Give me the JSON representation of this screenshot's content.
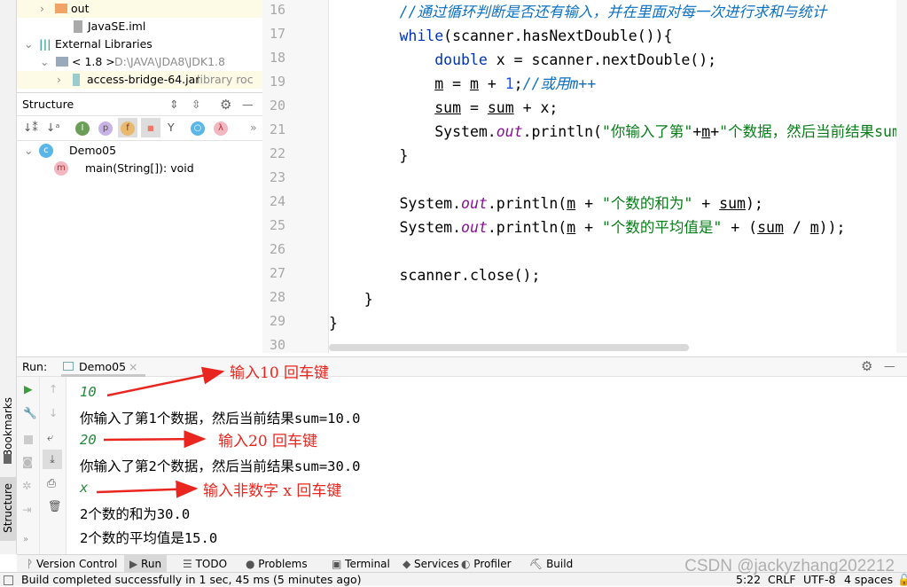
{
  "project_tree": [
    {
      "label": "out",
      "icon": "folder-icon",
      "expanded": false
    },
    {
      "label": "JavaSE.iml",
      "icon": "file-icon"
    },
    {
      "label": "External Libraries",
      "icon": "library-icon",
      "expanded": true
    },
    {
      "label": "< 1.8 >",
      "hint": "D:\\JAVA\\JDA8\\JDK1.8",
      "icon": "jdk-icon",
      "expanded": true
    },
    {
      "label": "access-bridge-64.jar",
      "hint": "library roc",
      "icon": "jar-icon",
      "expanded": false
    }
  ],
  "structure": {
    "title": "Structure",
    "class_name": "Demo05",
    "method": "main(String[]): void"
  },
  "editor": {
    "line_numbers": [
      "16",
      "17",
      "18",
      "19",
      "20",
      "21",
      "22",
      "23",
      "24",
      "25",
      "26",
      "27",
      "28",
      "29",
      "30"
    ],
    "lines": [
      [
        {
          "t": "        "
        },
        {
          "t": "//通过循环判断是否还有输入，并在里面对每一次进行求和与统计",
          "c": "cm"
        }
      ],
      [
        {
          "t": "        "
        },
        {
          "t": "while",
          "c": "kw"
        },
        {
          "t": "(scanner.hasNextDouble()){"
        }
      ],
      [
        {
          "t": "            "
        },
        {
          "t": "double",
          "c": "kw"
        },
        {
          "t": " x = scanner.nextDouble();"
        }
      ],
      [
        {
          "t": "            "
        },
        {
          "t": "m",
          "c": "ul"
        },
        {
          "t": " = "
        },
        {
          "t": "m",
          "c": "ul"
        },
        {
          "t": " + "
        },
        {
          "t": "1",
          "c": "nm"
        },
        {
          "t": ";"
        },
        {
          "t": "//或用m++",
          "c": "cm"
        }
      ],
      [
        {
          "t": "            "
        },
        {
          "t": "sum",
          "c": "ul"
        },
        {
          "t": " = "
        },
        {
          "t": "sum",
          "c": "ul"
        },
        {
          "t": " + x;"
        }
      ],
      [
        {
          "t": "            System."
        },
        {
          "t": "out",
          "c": "fd"
        },
        {
          "t": ".println("
        },
        {
          "t": "\"你输入了第\"",
          "c": "st"
        },
        {
          "t": "+"
        },
        {
          "t": "m",
          "c": "ul"
        },
        {
          "t": "+"
        },
        {
          "t": "\"个数据，然后当前结果sum=\"",
          "c": "st"
        }
      ],
      [
        {
          "t": "        }"
        }
      ],
      [
        {
          "t": ""
        }
      ],
      [
        {
          "t": "        System."
        },
        {
          "t": "out",
          "c": "fd"
        },
        {
          "t": ".println("
        },
        {
          "t": "m",
          "c": "ul"
        },
        {
          "t": " + "
        },
        {
          "t": "\"个数的和为\"",
          "c": "st"
        },
        {
          "t": " + "
        },
        {
          "t": "sum",
          "c": "ul"
        },
        {
          "t": ");"
        }
      ],
      [
        {
          "t": "        System."
        },
        {
          "t": "out",
          "c": "fd"
        },
        {
          "t": ".println("
        },
        {
          "t": "m",
          "c": "ul"
        },
        {
          "t": " + "
        },
        {
          "t": "\"个数的平均值是\"",
          "c": "st"
        },
        {
          "t": " + ("
        },
        {
          "t": "sum",
          "c": "ul"
        },
        {
          "t": " / "
        },
        {
          "t": "m",
          "c": "ul"
        },
        {
          "t": "));"
        }
      ],
      [
        {
          "t": ""
        }
      ],
      [
        {
          "t": "        scanner.close();"
        }
      ],
      [
        {
          "t": "    }"
        }
      ],
      [
        {
          "t": "}"
        }
      ],
      [
        {
          "t": ""
        }
      ]
    ]
  },
  "run": {
    "label": "Run:",
    "tab": "Demo05",
    "console": [
      {
        "text": "10",
        "input": true
      },
      {
        "text": "你输入了第1个数据，然后当前结果sum=10.0"
      },
      {
        "text": "20",
        "input": true
      },
      {
        "text": "你输入了第2个数据，然后当前结果sum=30.0"
      },
      {
        "text": "x",
        "input": true
      },
      {
        "text": "2个数的和为30.0"
      },
      {
        "text": "2个数的平均值是15.0"
      }
    ],
    "annotations": [
      "输入10 回车键",
      "输入20 回车键",
      "输入非数字 x 回车键"
    ],
    "annotation_color": "#e8261f"
  },
  "side_tabs": {
    "bookmarks": "Bookmarks",
    "structure": "Structure"
  },
  "bottom_tabs": [
    {
      "label": "Version Control",
      "icon": "branch-icon"
    },
    {
      "label": "Run",
      "icon": "play-icon",
      "active": true
    },
    {
      "label": "TODO",
      "icon": "list-icon"
    },
    {
      "label": "Problems",
      "icon": "warning-icon"
    },
    {
      "label": "Terminal",
      "icon": "terminal-icon"
    },
    {
      "label": "Services",
      "icon": "services-icon"
    },
    {
      "label": "Profiler",
      "icon": "profiler-icon"
    },
    {
      "label": "Build",
      "icon": "hammer-icon"
    }
  ],
  "status": {
    "message": "Build completed successfully in 1 sec, 45 ms (5 minutes ago)",
    "position": "5:22",
    "line_sep": "CRLF",
    "encoding": "UTF-8",
    "indent": "4 spaces"
  },
  "watermark": "CSDN @jackyzhang202212"
}
